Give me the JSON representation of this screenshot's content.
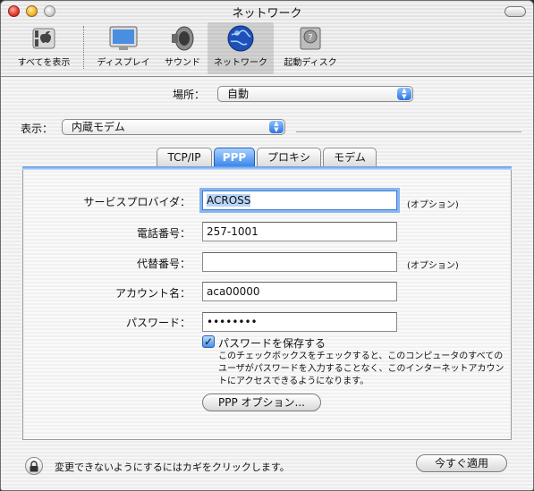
{
  "window": {
    "title": "ネットワーク"
  },
  "toolbar": {
    "items": [
      {
        "label": "すべてを表示",
        "icon": "show-all-icon"
      },
      {
        "label": "ディスプレイ",
        "icon": "display-icon"
      },
      {
        "label": "サウンド",
        "icon": "sound-icon"
      },
      {
        "label": "ネットワーク",
        "icon": "network-globe-icon",
        "selected": true
      },
      {
        "label": "起動ディスク",
        "icon": "startup-disk-icon"
      }
    ]
  },
  "location": {
    "label": "場所：",
    "value": "自動"
  },
  "show": {
    "label": "表示：",
    "value": "内蔵モデム"
  },
  "tabs": [
    {
      "label": "TCP/IP",
      "active": false
    },
    {
      "label": "PPP",
      "active": true
    },
    {
      "label": "プロキシ",
      "active": false
    },
    {
      "label": "モデム",
      "active": false
    }
  ],
  "form": {
    "service_provider": {
      "label": "サービスプロバイダ：",
      "value": "ACROSS",
      "hint": "(オプション)"
    },
    "phone": {
      "label": "電話番号：",
      "value": "257-1001"
    },
    "alt_phone": {
      "label": "代替番号：",
      "value": "",
      "hint": "(オプション)"
    },
    "account": {
      "label": "アカウント名：",
      "value": "aca00000"
    },
    "password": {
      "label": "パスワード：",
      "value": "••••••••"
    },
    "save_password": {
      "label": "パスワードを保存する",
      "checked": true,
      "note": "このチェックボックスをチェックすると、このコンピュータのすべてのユーザがパスワードを入力することなく、このインターネットアカウントにアクセスできるようになります。"
    },
    "ppp_options_button": "PPP オプション..."
  },
  "footer": {
    "lock_text": "変更できないようにするにはカギをクリックします。",
    "apply_button": "今すぐ適用"
  },
  "colors": {
    "accent": "#3b86e8",
    "focus_ring": "#86b5ef"
  }
}
